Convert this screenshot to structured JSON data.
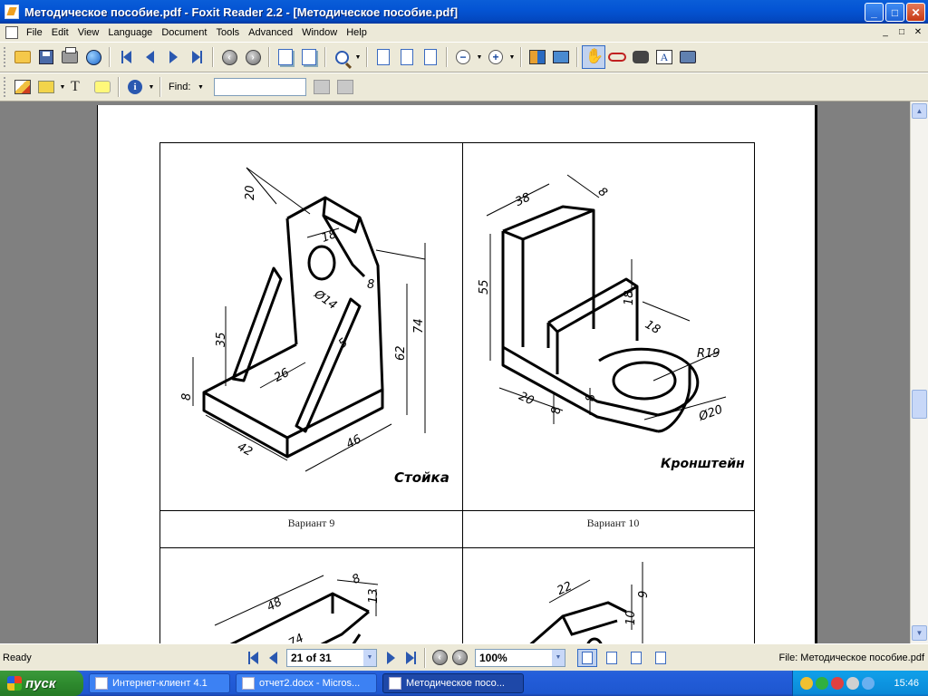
{
  "window": {
    "title": "Методическое пособие.pdf - Foxit Reader 2.2 - [Методическое пособие.pdf]",
    "min_label": "_",
    "max_label": "□",
    "close_label": "✕"
  },
  "menu": {
    "items": [
      "File",
      "Edit",
      "View",
      "Language",
      "Document",
      "Tools",
      "Advanced",
      "Window",
      "Help"
    ],
    "mdi_buttons": [
      "_",
      "□",
      "✕"
    ]
  },
  "toolbar2": {
    "find_label": "Find:",
    "find_value": ""
  },
  "document": {
    "captions": [
      "Вариант 9",
      "Вариант 10"
    ],
    "drawing_labels": [
      "Стойка",
      "Кронштейн"
    ],
    "dims_left": [
      "20",
      "18",
      "8",
      "Ø14",
      "5",
      "35",
      "26",
      "8",
      "42",
      "46",
      "62",
      "74"
    ],
    "dims_right": [
      "38",
      "8",
      "55",
      "18",
      "18",
      "R19",
      "20",
      "8",
      "8",
      "Ø20"
    ],
    "dims_bottom_left": [
      "48",
      "74",
      "8",
      "13"
    ],
    "dims_bottom_right": [
      "22",
      "10",
      "9"
    ]
  },
  "statusbar": {
    "status": "Ready",
    "page_value": "21 of 31",
    "zoom_value": "100%",
    "file_status": "File: Методическое пособие.pdf"
  },
  "taskbar": {
    "start_label": "пуск",
    "tasks": [
      "Интернет-клиент 4.1",
      "отчет2.docx - Micros...",
      "Методическое посо..."
    ],
    "clock": "15:46"
  },
  "colors": {
    "titlebar": "#0454d4",
    "taskbar": "#245edb",
    "start": "#2e8a2e",
    "doc_background": "#808080"
  }
}
